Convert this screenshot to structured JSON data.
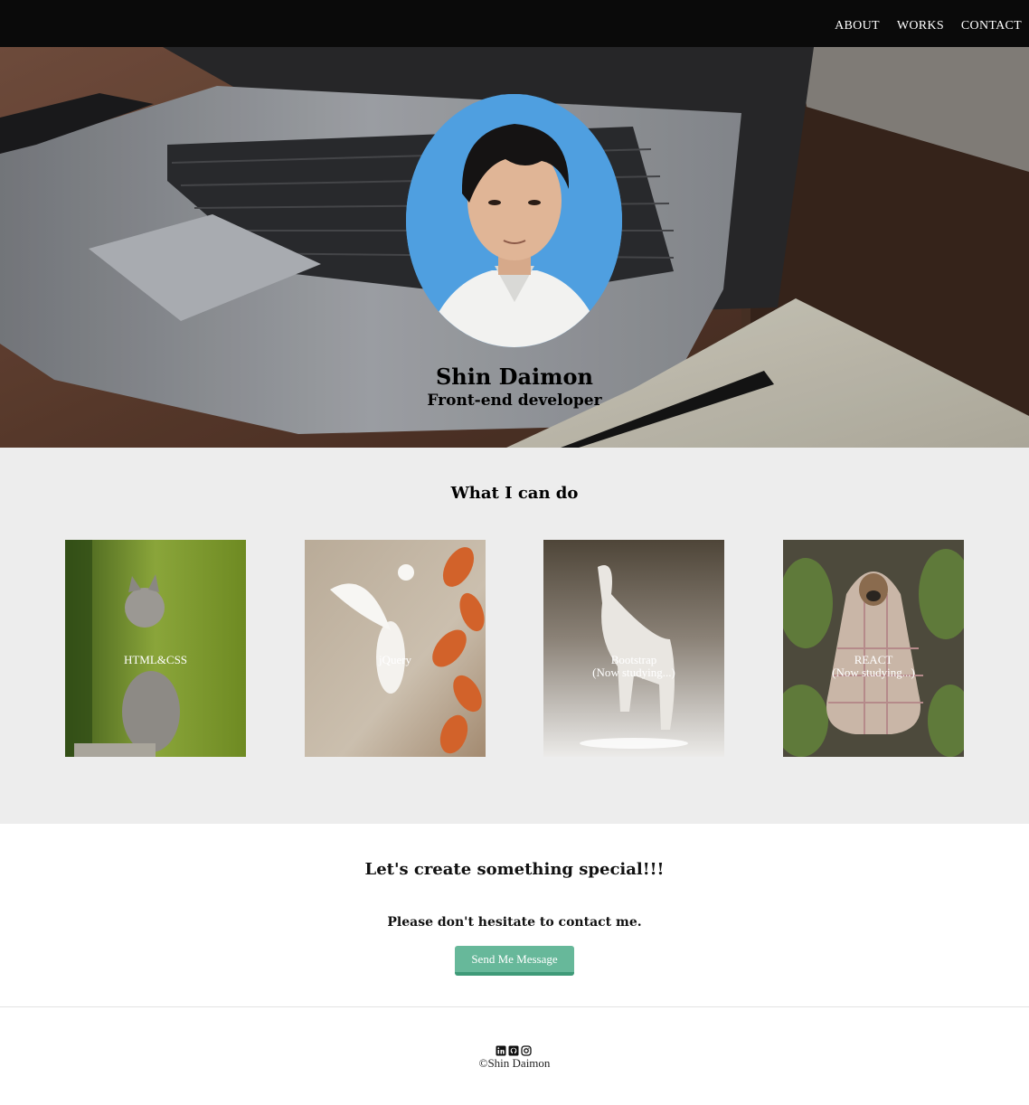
{
  "nav": {
    "items": [
      {
        "label": "ABOUT"
      },
      {
        "label": "WORKS"
      },
      {
        "label": "CONTACT"
      }
    ]
  },
  "hero": {
    "name": "Shin Daimon",
    "role": "Front-end developer"
  },
  "skills": {
    "heading": "What I can do",
    "cards": [
      {
        "line1": "HTML&CSS",
        "line2": ""
      },
      {
        "line1": "jQuery",
        "line2": ""
      },
      {
        "line1": "Bootstrap",
        "line2": "(Now studying...)"
      },
      {
        "line1": "REACT",
        "line2": "(Now studying...)"
      }
    ]
  },
  "contact": {
    "heading": "Let's create something special!!!",
    "text": "Please don't hesitate to contact me.",
    "button_label": "Send Me Message"
  },
  "footer": {
    "icons": [
      "linkedin-icon",
      "github-icon",
      "instagram-icon"
    ],
    "copyright": "©Shin Daimon"
  },
  "colors": {
    "nav_bg": "#0a0a0a",
    "skills_bg": "#ededed",
    "button": "#67b89a"
  }
}
